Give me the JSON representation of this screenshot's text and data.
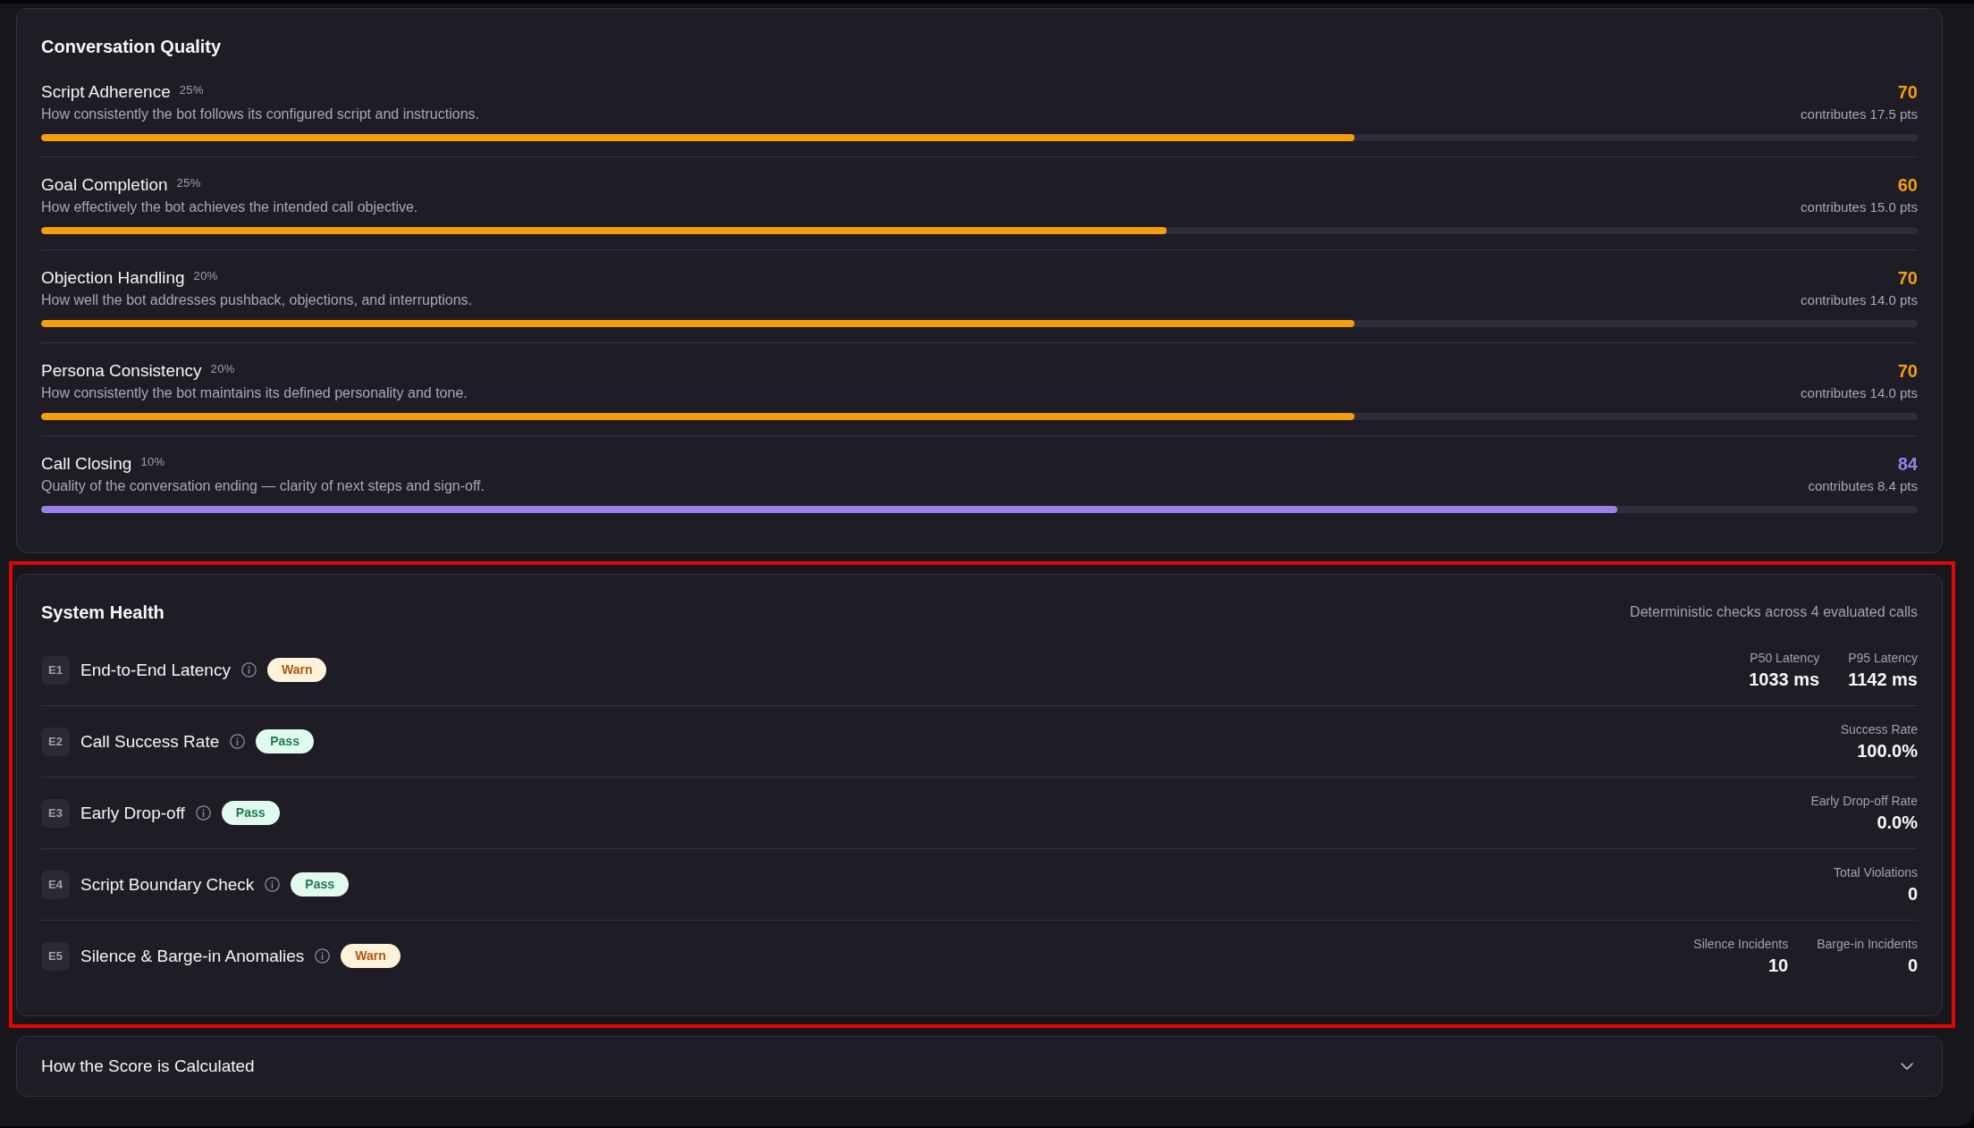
{
  "conversation_quality": {
    "title": "Conversation Quality",
    "criteria": [
      {
        "name": "Script Adherence",
        "weight": "25%",
        "description": "How consistently the bot follows its configured script and instructions.",
        "score": "70",
        "contribution": "contributes 17.5 pts",
        "level": 0.7,
        "color": "#f59e0b"
      },
      {
        "name": "Goal Completion",
        "weight": "25%",
        "description": "How effectively the bot achieves the intended call objective.",
        "score": "60",
        "contribution": "contributes 15.0 pts",
        "level": 0.6,
        "color": "#f59e0b"
      },
      {
        "name": "Objection Handling",
        "weight": "20%",
        "description": "How well the bot addresses pushback, objections, and interruptions.",
        "score": "70",
        "contribution": "contributes 14.0 pts",
        "level": 0.7,
        "color": "#f59e0b"
      },
      {
        "name": "Persona Consistency",
        "weight": "20%",
        "description": "How consistently the bot maintains its defined personality and tone.",
        "score": "70",
        "contribution": "contributes 14.0 pts",
        "level": 0.7,
        "color": "#f59e0b"
      },
      {
        "name": "Call Closing",
        "weight": "10%",
        "description": "Quality of the conversation ending — clarity of next steps and sign-off.",
        "score": "84",
        "contribution": "contributes 8.4 pts",
        "level": 0.84,
        "color": "#9b80ea"
      }
    ]
  },
  "system_health": {
    "highlighted": true,
    "title": "System Health",
    "subtitle": "Deterministic checks across 4 evaluated calls",
    "checks": [
      {
        "code": "E1",
        "name": "End-to-End Latency",
        "status": "Warn",
        "kind": "warn",
        "metrics": [
          {
            "label": "P50 Latency",
            "value": "1033 ms"
          },
          {
            "label": "P95 Latency",
            "value": "1142 ms"
          }
        ]
      },
      {
        "code": "E2",
        "name": "Call Success Rate",
        "status": "Pass",
        "kind": "pass",
        "metrics": [
          {
            "label": "Success Rate",
            "value": "100.0%"
          }
        ]
      },
      {
        "code": "E3",
        "name": "Early Drop-off",
        "status": "Pass",
        "kind": "pass",
        "metrics": [
          {
            "label": "Early Drop-off Rate",
            "value": "0.0%"
          }
        ]
      },
      {
        "code": "E4",
        "name": "Script Boundary Check",
        "status": "Pass",
        "kind": "pass",
        "metrics": [
          {
            "label": "Total Violations",
            "value": "0"
          }
        ]
      },
      {
        "code": "E5",
        "name": "Silence & Barge-in Anomalies",
        "status": "Warn",
        "kind": "warn",
        "metrics": [
          {
            "label": "Silence Incidents",
            "value": "10"
          },
          {
            "label": "Barge-in Incidents",
            "value": "0"
          }
        ]
      }
    ]
  },
  "score_explanation": {
    "title": "How the Score is Calculated",
    "expanded": false
  }
}
